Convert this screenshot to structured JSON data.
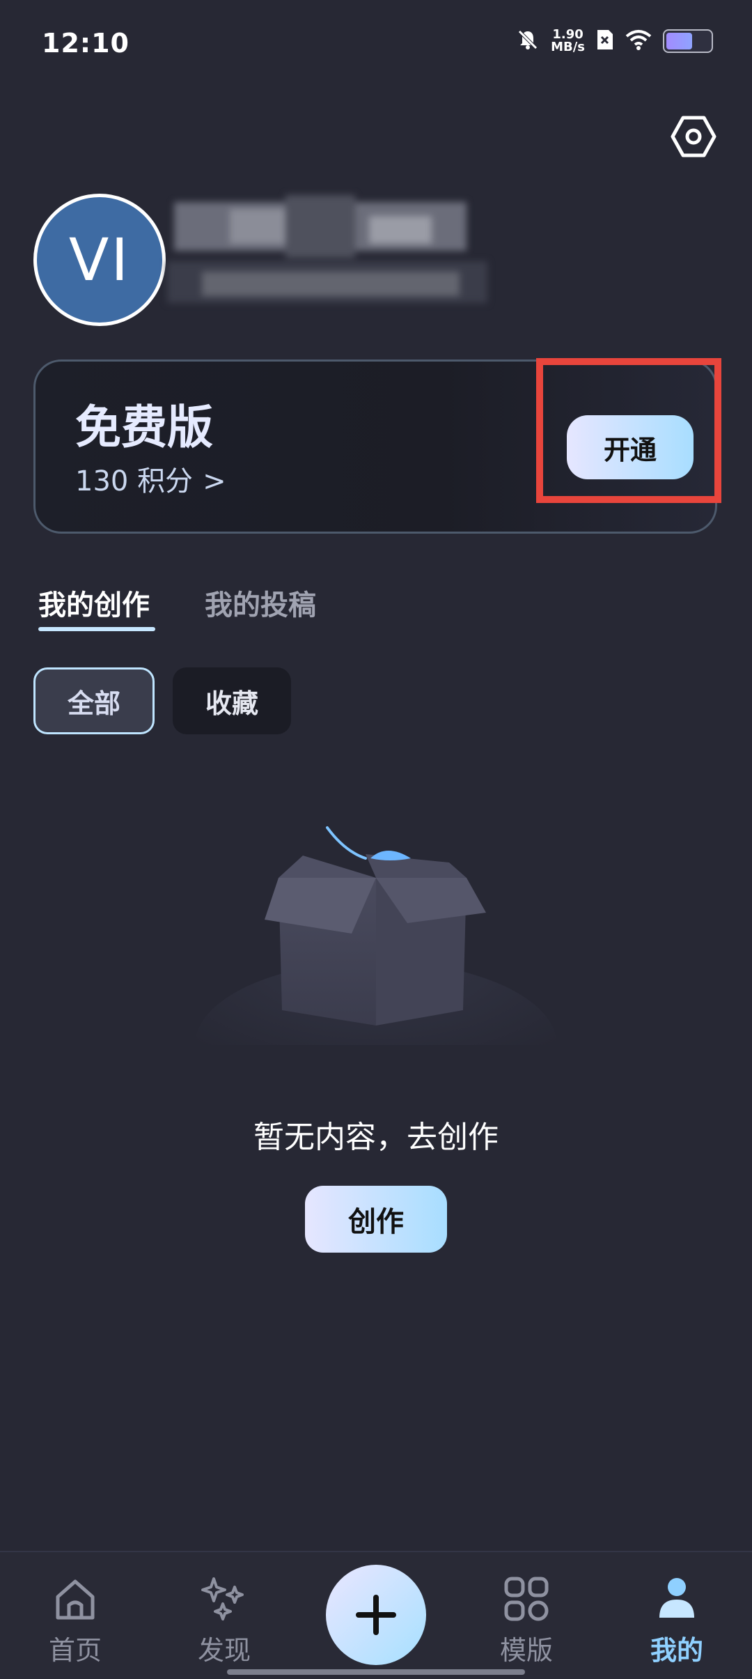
{
  "status_bar": {
    "time": "12:10",
    "net_speed_value": "1.90",
    "net_speed_unit": "MB/s",
    "icons": [
      "bell-off-icon",
      "sim-x-icon",
      "wifi-icon",
      "battery-icon"
    ],
    "battery_level": 0.55
  },
  "profile": {
    "avatar_initials": "VI",
    "avatar_color": "#3e6ba3"
  },
  "membership": {
    "plan": "免费版",
    "points_text": "130 积分",
    "points_arrow": ">",
    "activate_label": "开通",
    "highlight_color": "#e8453c"
  },
  "tabs": [
    {
      "label": "我的创作",
      "active": true
    },
    {
      "label": "我的投稿",
      "active": false
    }
  ],
  "filters": [
    {
      "label": "全部",
      "selected": true
    },
    {
      "label": "收藏",
      "selected": false
    }
  ],
  "empty_state": {
    "message": "暂无内容，去创作",
    "create_label": "创作"
  },
  "bottom_nav": {
    "items": [
      {
        "label": "首页",
        "icon": "home-icon",
        "active": false
      },
      {
        "label": "发现",
        "icon": "sparkles-icon",
        "active": false
      },
      {
        "label": "模版",
        "icon": "grid-icon",
        "active": false
      },
      {
        "label": "我的",
        "icon": "person-icon",
        "active": true
      }
    ],
    "center_icon": "plus-icon",
    "active_color": "#8fd0ff"
  }
}
